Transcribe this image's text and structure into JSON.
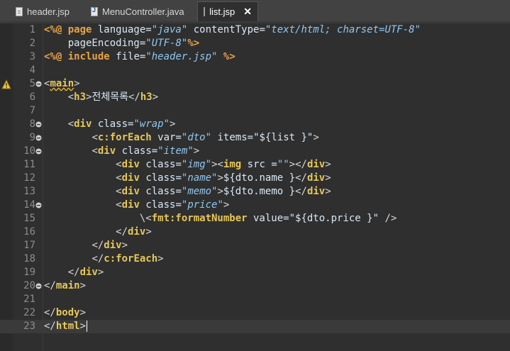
{
  "tabs": [
    {
      "label": "header.jsp",
      "icon": "jsp-file-icon",
      "active": false
    },
    {
      "label": "MenuController.java",
      "icon": "java-file-icon",
      "active": false
    },
    {
      "label": "list.jsp",
      "icon": "jsp-file-icon",
      "active": true
    }
  ],
  "editor": {
    "current_line": 23,
    "lines": [
      {
        "n": "1",
        "fold": false,
        "segs": [
          [
            "dir",
            "<%@ page "
          ],
          [
            "attr",
            "language="
          ],
          [
            "val",
            "\"java\""
          ],
          [
            "attr",
            " contentType="
          ],
          [
            "val",
            "\"text/html; charset=UTF-8\""
          ]
        ]
      },
      {
        "n": "2",
        "fold": false,
        "segs": [
          [
            "txt",
            "    "
          ],
          [
            "attr",
            "pageEncoding="
          ],
          [
            "val",
            "\"UTF-8\""
          ],
          [
            "dir",
            "%>"
          ]
        ]
      },
      {
        "n": "3",
        "fold": false,
        "segs": [
          [
            "dir",
            "<%@ include "
          ],
          [
            "attr",
            "file="
          ],
          [
            "val",
            "\"header.jsp\""
          ],
          [
            "dir",
            " %>"
          ]
        ]
      },
      {
        "n": "4",
        "fold": false,
        "segs": []
      },
      {
        "n": "5",
        "fold": true,
        "warn": true,
        "segs": [
          [
            "brk",
            "<"
          ],
          [
            "tagsq",
            "main"
          ],
          [
            "brk",
            ">"
          ]
        ]
      },
      {
        "n": "6",
        "fold": false,
        "segs": [
          [
            "txt",
            "    "
          ],
          [
            "brk",
            "<"
          ],
          [
            "tag",
            "h3"
          ],
          [
            "brk",
            ">"
          ],
          [
            "txt",
            "전체목록"
          ],
          [
            "brk",
            "</"
          ],
          [
            "tag",
            "h3"
          ],
          [
            "brk",
            ">"
          ]
        ]
      },
      {
        "n": "7",
        "fold": false,
        "segs": []
      },
      {
        "n": "8",
        "fold": true,
        "segs": [
          [
            "txt",
            "    "
          ],
          [
            "brk",
            "<"
          ],
          [
            "tag",
            "div"
          ],
          [
            "attr",
            " class="
          ],
          [
            "val",
            "\"wrap\""
          ],
          [
            "brk",
            ">"
          ]
        ]
      },
      {
        "n": "9",
        "fold": true,
        "segs": [
          [
            "txt",
            "        "
          ],
          [
            "brk",
            "<"
          ],
          [
            "tag",
            "c:forEach"
          ],
          [
            "attr",
            " var="
          ],
          [
            "val",
            "\"dto\""
          ],
          [
            "attr",
            " items="
          ],
          [
            "txt",
            "\"${list }\""
          ],
          [
            "brk",
            ">"
          ]
        ]
      },
      {
        "n": "10",
        "fold": true,
        "segs": [
          [
            "txt",
            "        "
          ],
          [
            "brk",
            "<"
          ],
          [
            "tag",
            "div"
          ],
          [
            "attr",
            " class="
          ],
          [
            "val",
            "\"item\""
          ],
          [
            "brk",
            ">"
          ]
        ]
      },
      {
        "n": "11",
        "fold": false,
        "segs": [
          [
            "txt",
            "            "
          ],
          [
            "brk",
            "<"
          ],
          [
            "tag",
            "div"
          ],
          [
            "attr",
            " class="
          ],
          [
            "val",
            "\"img\""
          ],
          [
            "brk",
            ">"
          ],
          [
            "brk",
            "<"
          ],
          [
            "tag",
            "img"
          ],
          [
            "attr",
            " src ="
          ],
          [
            "val",
            "\"\""
          ],
          [
            "brk",
            "></"
          ],
          [
            "tag",
            "div"
          ],
          [
            "brk",
            ">"
          ]
        ]
      },
      {
        "n": "12",
        "fold": false,
        "segs": [
          [
            "txt",
            "            "
          ],
          [
            "brk",
            "<"
          ],
          [
            "tag",
            "div"
          ],
          [
            "attr",
            " class="
          ],
          [
            "val",
            "\"name\""
          ],
          [
            "brk",
            ">"
          ],
          [
            "txt",
            "${dto.name }"
          ],
          [
            "brk",
            "</"
          ],
          [
            "tag",
            "div"
          ],
          [
            "brk",
            ">"
          ]
        ]
      },
      {
        "n": "13",
        "fold": false,
        "segs": [
          [
            "txt",
            "            "
          ],
          [
            "brk",
            "<"
          ],
          [
            "tag",
            "div"
          ],
          [
            "attr",
            " class="
          ],
          [
            "val",
            "\"memo\""
          ],
          [
            "brk",
            ">"
          ],
          [
            "txt",
            "${dto.memo }"
          ],
          [
            "brk",
            "</"
          ],
          [
            "tag",
            "div"
          ],
          [
            "brk",
            ">"
          ]
        ]
      },
      {
        "n": "14",
        "fold": true,
        "segs": [
          [
            "txt",
            "            "
          ],
          [
            "brk",
            "<"
          ],
          [
            "tag",
            "div"
          ],
          [
            "attr",
            " class="
          ],
          [
            "val",
            "\"price\""
          ],
          [
            "brk",
            ">"
          ]
        ]
      },
      {
        "n": "15",
        "fold": false,
        "segs": [
          [
            "txt",
            "                "
          ],
          [
            "brk",
            "\\<"
          ],
          [
            "tag",
            "fmt:formatNumber"
          ],
          [
            "attr",
            " value="
          ],
          [
            "txt",
            "\"${dto.price }\""
          ],
          [
            "brk",
            " />"
          ]
        ]
      },
      {
        "n": "16",
        "fold": false,
        "segs": [
          [
            "txt",
            "            "
          ],
          [
            "brk",
            "</"
          ],
          [
            "tag",
            "div"
          ],
          [
            "brk",
            ">"
          ]
        ]
      },
      {
        "n": "17",
        "fold": false,
        "segs": [
          [
            "txt",
            "        "
          ],
          [
            "brk",
            "</"
          ],
          [
            "tag",
            "div"
          ],
          [
            "brk",
            ">"
          ]
        ]
      },
      {
        "n": "18",
        "fold": false,
        "segs": [
          [
            "txt",
            "        "
          ],
          [
            "brk",
            "</"
          ],
          [
            "tag",
            "c:forEach"
          ],
          [
            "brk",
            ">"
          ]
        ]
      },
      {
        "n": "19",
        "fold": false,
        "segs": [
          [
            "txt",
            "    "
          ],
          [
            "brk",
            "</"
          ],
          [
            "tag",
            "div"
          ],
          [
            "brk",
            ">"
          ]
        ]
      },
      {
        "n": "20",
        "fold": true,
        "segs": [
          [
            "brk",
            "</"
          ],
          [
            "tag",
            "main"
          ],
          [
            "brk",
            ">"
          ]
        ]
      },
      {
        "n": "21",
        "fold": false,
        "segs": []
      },
      {
        "n": "22",
        "fold": false,
        "segs": [
          [
            "brk",
            "</"
          ],
          [
            "tag",
            "body"
          ],
          [
            "brk",
            ">"
          ]
        ]
      },
      {
        "n": "23",
        "fold": false,
        "caret": true,
        "segs": [
          [
            "brk",
            "</"
          ],
          [
            "tag",
            "html"
          ],
          [
            "brk",
            ">"
          ]
        ]
      }
    ]
  }
}
